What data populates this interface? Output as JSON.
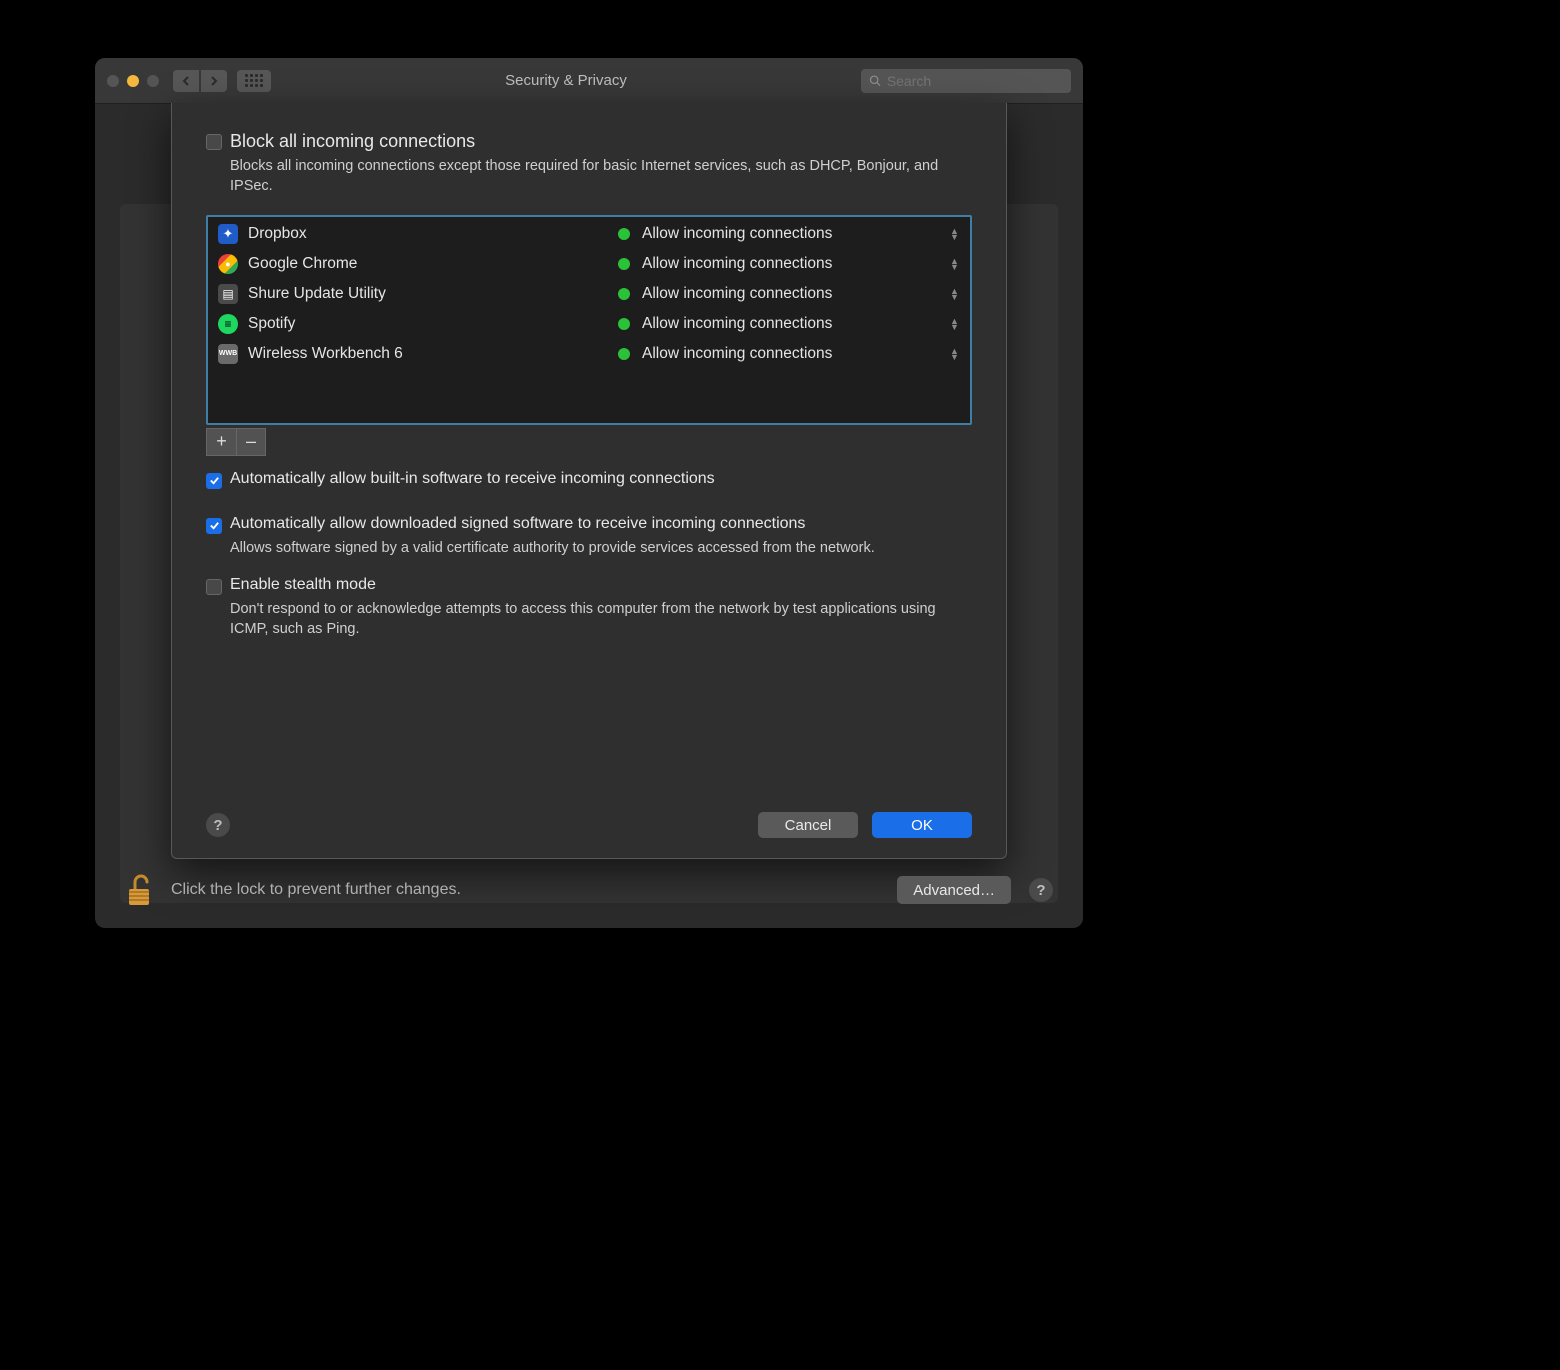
{
  "window": {
    "title": "Security & Privacy",
    "search_placeholder": "Search"
  },
  "sheet": {
    "block_all": {
      "checked": false,
      "label": "Block all incoming connections",
      "description": "Blocks all incoming connections except those required for basic Internet services, such as DHCP, Bonjour, and IPSec."
    },
    "apps": [
      {
        "name": "Dropbox",
        "icon_bg": "#1f5cc7",
        "icon_glyph": "⬥",
        "status": "Allow incoming connections"
      },
      {
        "name": "Google Chrome",
        "icon_bg": "#dddddd",
        "icon_glyph": "◉",
        "status": "Allow incoming connections"
      },
      {
        "name": "Shure Update Utility",
        "icon_bg": "#4a4a4a",
        "icon_glyph": "▤",
        "status": "Allow incoming connections"
      },
      {
        "name": "Spotify",
        "icon_bg": "#1ed760",
        "icon_glyph": "≋",
        "status": "Allow incoming connections"
      },
      {
        "name": "Wireless Workbench 6",
        "icon_bg": "#6a6a6a",
        "icon_glyph": "WWB",
        "status": "Allow incoming connections"
      }
    ],
    "auto_builtin": {
      "checked": true,
      "label": "Automatically allow built-in software to receive incoming connections"
    },
    "auto_signed": {
      "checked": true,
      "label": "Automatically allow downloaded signed software to receive incoming connections",
      "description": "Allows software signed by a valid certificate authority to provide services accessed from the network."
    },
    "stealth": {
      "checked": false,
      "label": "Enable stealth mode",
      "description": "Don't respond to or acknowledge attempts to access this computer from the network by test applications using ICMP, such as Ping."
    },
    "cancel": "Cancel",
    "ok": "OK",
    "add": "+",
    "remove": "–"
  },
  "footer": {
    "lock_msg": "Click the lock to prevent further changes.",
    "advanced": "Advanced…"
  }
}
